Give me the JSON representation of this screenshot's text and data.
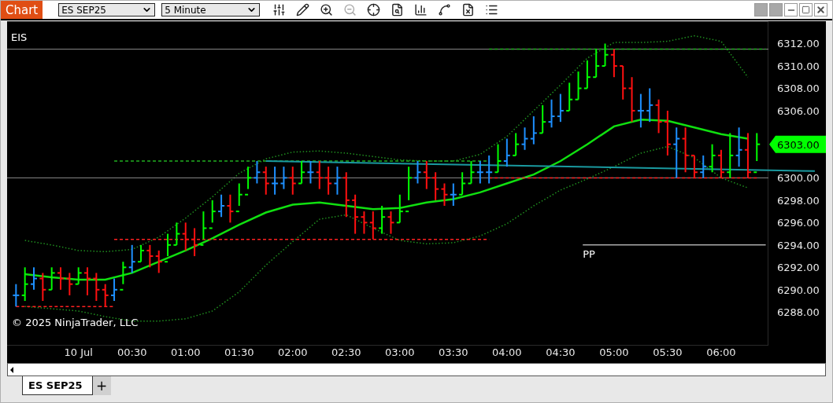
{
  "window": {
    "title": "Chart",
    "instrument": "ES SEP25",
    "interval": "5 Minute"
  },
  "chart": {
    "instrument_label": "EIS",
    "copyright": "© 2025 NinjaTrader, LLC",
    "last_price": "6303.00",
    "pivot_label": "PP",
    "chart_data": {
      "type": "line",
      "categories": [
        null,
        null,
        "10 Jul",
        null,
        "00:30",
        null,
        "01:00",
        null,
        "01:30",
        null,
        "02:00",
        null,
        "02:30",
        null,
        "03:00",
        null,
        "03:30",
        null,
        "04:00",
        null,
        "04:30",
        null,
        "05:00",
        null,
        "05:30",
        null,
        "06:00",
        null
      ],
      "series": [
        {
          "color": "#10e010",
          "line_style": "solid",
          "values": [
            6291.4,
            6291.1,
            6290.9,
            6290.9,
            6291.5,
            6292.5,
            6293.5,
            6294.6,
            6295.8,
            6296.9,
            6297.6,
            6297.8,
            6297.5,
            6297.2,
            6297.3,
            6297.8,
            6298.1,
            6298.7,
            6299.5,
            6300.3,
            6301.5,
            6303.0,
            6304.6,
            6305.2,
            6305.1,
            6304.5,
            6303.9,
            6303.5
          ]
        },
        {
          "color": "#1f8f1f",
          "line_style": "dotted",
          "values": [
            6294.4,
            6294.0,
            6293.5,
            6293.4,
            6293.6,
            6294.7,
            6296.4,
            6298.3,
            6300.4,
            6301.7,
            6302.3,
            6302.4,
            6302.2,
            6301.9,
            6301.6,
            6301.5,
            6301.5,
            6302.1,
            6303.7,
            6306.0,
            6308.3,
            6310.7,
            6312.1,
            6312.1,
            6312.2,
            6312.7,
            6312.2,
            6309.0
          ]
        },
        {
          "color": "#1f8f1f",
          "line_style": "dotted",
          "values": [
            6288.5,
            6288.3,
            6288.1,
            6287.6,
            6287.2,
            6287.2,
            6287.4,
            6288.1,
            6289.8,
            6292.2,
            6294.3,
            6296.3,
            6296.7,
            6295.5,
            6294.4,
            6294.1,
            6294.2,
            6294.8,
            6295.9,
            6297.5,
            6298.9,
            6299.9,
            6301.0,
            6302.2,
            6302.8,
            6301.8,
            6300.0,
            6299.1
          ]
        }
      ],
      "ylim": [
        6285,
        6314
      ],
      "yticks": [
        {
          "value": 6312,
          "label": "6312.00"
        },
        {
          "value": 6310,
          "label": "6310.00"
        },
        {
          "value": 6308,
          "label": "6308.00"
        },
        {
          "value": 6306,
          "label": "6306.00"
        },
        {
          "value": 6300,
          "label": "6300.00"
        },
        {
          "value": 6298,
          "label": "6298.00"
        },
        {
          "value": 6296,
          "label": "6296.00"
        },
        {
          "value": 6294,
          "label": "6294.00"
        },
        {
          "value": 6292,
          "label": "6292.00"
        },
        {
          "value": 6290,
          "label": "6290.00"
        },
        {
          "value": 6288,
          "label": "6288.00"
        }
      ]
    }
  },
  "tabs": [
    {
      "label": "ES SEP25",
      "selected": true
    }
  ],
  "add_tab": "+"
}
